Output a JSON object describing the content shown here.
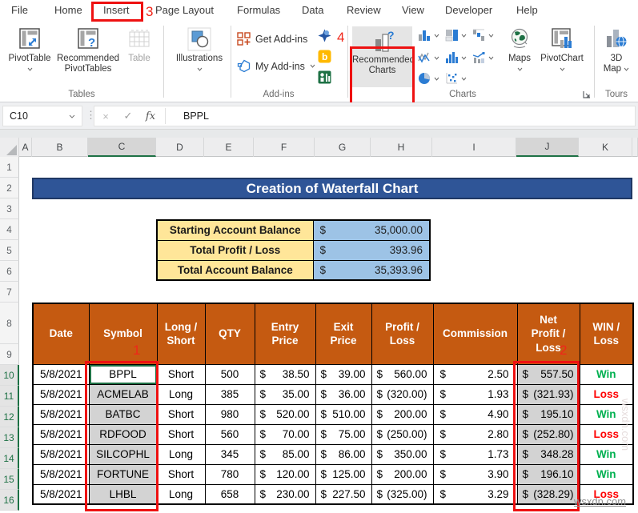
{
  "tabs": [
    "File",
    "Home",
    "Insert",
    "Page Layout",
    "Formulas",
    "Data",
    "Review",
    "View",
    "Developer",
    "Help"
  ],
  "ribbon": {
    "tables": {
      "group_label": "Tables",
      "pivottable": "PivotTable",
      "recommended_pivottables_1": "Recommended",
      "recommended_pivottables_2": "PivotTables",
      "table": "Table"
    },
    "illustrations": {
      "label": "Illustrations"
    },
    "addins": {
      "group_label": "Add-ins",
      "get": "Get Add-ins",
      "my": "My Add-ins"
    },
    "charts": {
      "group_label": "Charts",
      "recommended_1": "Recommended",
      "recommended_2": "Charts",
      "maps": "Maps",
      "pivotchart": "PivotChart"
    },
    "tours": {
      "group_label": "Tours",
      "map3d_1": "3D",
      "map3d_2": "Map"
    }
  },
  "formula_bar": {
    "name_box": "C10",
    "formula": "BPPL",
    "fx": "fx",
    "cancel": "×",
    "enter": "✓"
  },
  "annotations": {
    "one": "1",
    "two": "2",
    "three": "3",
    "four": "4"
  },
  "grid": {
    "cols": [
      "A",
      "B",
      "C",
      "D",
      "E",
      "F",
      "G",
      "H",
      "I",
      "J",
      "K"
    ],
    "rows": [
      "1",
      "2",
      "3",
      "4",
      "5",
      "6",
      "7",
      "8",
      "9",
      "10",
      "11",
      "12",
      "13",
      "14",
      "15",
      "16"
    ]
  },
  "sheet": {
    "title": "Creation of Waterfall Chart",
    "currency": "$",
    "summary": [
      {
        "label": "Starting Account Balance",
        "value": "35,000.00"
      },
      {
        "label": "Total Profit / Loss",
        "value": "393.96"
      },
      {
        "label": "Total Account Balance",
        "value": "35,393.96"
      }
    ],
    "table": {
      "headers": [
        "Date",
        "Symbol",
        "Long / Short",
        "QTY",
        "Entry Price",
        "Exit Price",
        "Profit / Loss",
        "Commission",
        "Net Profit / Loss",
        "WIN / Loss"
      ],
      "rows": [
        {
          "date": "5/8/2021",
          "symbol": "BPPL",
          "ls": "Short",
          "qty": "500",
          "entry": "38.50",
          "exit": "39.00",
          "pl": "560.00",
          "comm": "2.50",
          "net": "557.50",
          "win": "Win"
        },
        {
          "date": "5/8/2021",
          "symbol": "ACMELAB",
          "ls": "Long",
          "qty": "385",
          "entry": "35.00",
          "exit": "36.00",
          "pl": "(320.00)",
          "comm": "1.93",
          "net": "(321.93)",
          "win": "Loss"
        },
        {
          "date": "5/8/2021",
          "symbol": "BATBC",
          "ls": "Short",
          "qty": "980",
          "entry": "520.00",
          "exit": "510.00",
          "pl": "200.00",
          "comm": "4.90",
          "net": "195.10",
          "win": "Win"
        },
        {
          "date": "5/8/2021",
          "symbol": "RDFOOD",
          "ls": "Short",
          "qty": "560",
          "entry": "70.00",
          "exit": "75.00",
          "pl": "(250.00)",
          "comm": "2.80",
          "net": "(252.80)",
          "win": "Loss"
        },
        {
          "date": "5/8/2021",
          "symbol": "SILCOPHL",
          "ls": "Long",
          "qty": "345",
          "entry": "85.00",
          "exit": "86.00",
          "pl": "350.00",
          "comm": "1.73",
          "net": "348.28",
          "win": "Win"
        },
        {
          "date": "5/8/2021",
          "symbol": "FORTUNE",
          "ls": "Short",
          "qty": "780",
          "entry": "120.00",
          "exit": "125.00",
          "pl": "200.00",
          "comm": "3.90",
          "net": "196.10",
          "win": "Win"
        },
        {
          "date": "5/8/2021",
          "symbol": "LHBL",
          "ls": "Long",
          "qty": "658",
          "entry": "230.00",
          "exit": "227.50",
          "pl": "(325.00)",
          "comm": "3.29",
          "net": "(328.29)",
          "win": "Loss"
        }
      ]
    }
  },
  "watermark": "wsxdn.com",
  "colors": {
    "table_header_orange": "#C55A11",
    "banner_blue": "#2F5597",
    "banner_border": "#203864",
    "summary_label_yellow": "#FFE699",
    "summary_value_blue": "#9DC3E6",
    "win_green": "#00B050",
    "loss_red": "#FF0000",
    "annotation_red": "#EE1111",
    "selection_gray": "#D3D3D3",
    "excel_accent_green": "#1E7145"
  }
}
